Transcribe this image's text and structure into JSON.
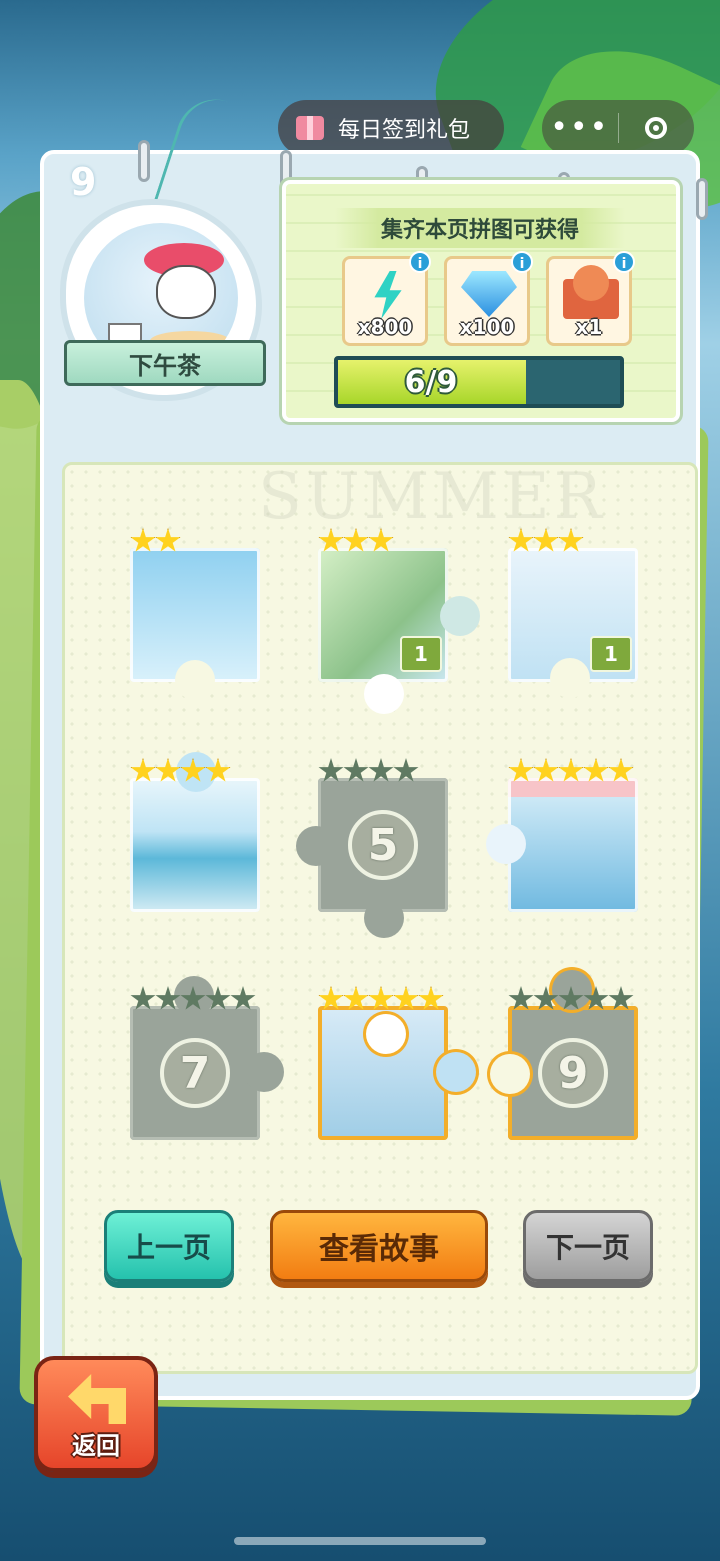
{
  "top_bar": {
    "gift_label": "每日签到礼包",
    "more_icon": "more-dots-icon",
    "close_icon": "target-ring-icon"
  },
  "page": {
    "number": "9"
  },
  "badge": {
    "title": "下午茶"
  },
  "rewards": {
    "title": "集齐本页拼图可获得",
    "items": [
      {
        "icon": "lightning-energy-icon",
        "qty": "x800",
        "info": "i"
      },
      {
        "icon": "diamond-gem-icon",
        "qty": "x100",
        "info": "i"
      },
      {
        "icon": "character-box-icon",
        "qty": "x1",
        "info": "i"
      }
    ],
    "progress": {
      "label": "6/9",
      "fraction": 0.667
    }
  },
  "watermark": "SUMMER",
  "puzzles": [
    {
      "index": 1,
      "stars": 2,
      "unlocked": true,
      "scene": "sky-seagull"
    },
    {
      "index": 2,
      "stars": 3,
      "unlocked": true,
      "scene": "roses",
      "count": "1"
    },
    {
      "index": 3,
      "stars": 3,
      "unlocked": true,
      "scene": "cafe-window",
      "count": "1"
    },
    {
      "index": 4,
      "stars": 4,
      "unlocked": true,
      "scene": "seaside-church"
    },
    {
      "index": 5,
      "stars": 4,
      "unlocked": false,
      "number": "5"
    },
    {
      "index": 6,
      "stars": 5,
      "unlocked": true,
      "scene": "cafe-shop"
    },
    {
      "index": 7,
      "stars": 5,
      "unlocked": false,
      "number": "7"
    },
    {
      "index": 8,
      "stars": 5,
      "unlocked": true,
      "scene": "tea-table",
      "selected": true
    },
    {
      "index": 9,
      "stars": 5,
      "unlocked": false,
      "number": "9",
      "selected": true
    }
  ],
  "buttons": {
    "prev": "上一页",
    "story": "查看故事",
    "next": "下一页",
    "back": "返回"
  }
}
